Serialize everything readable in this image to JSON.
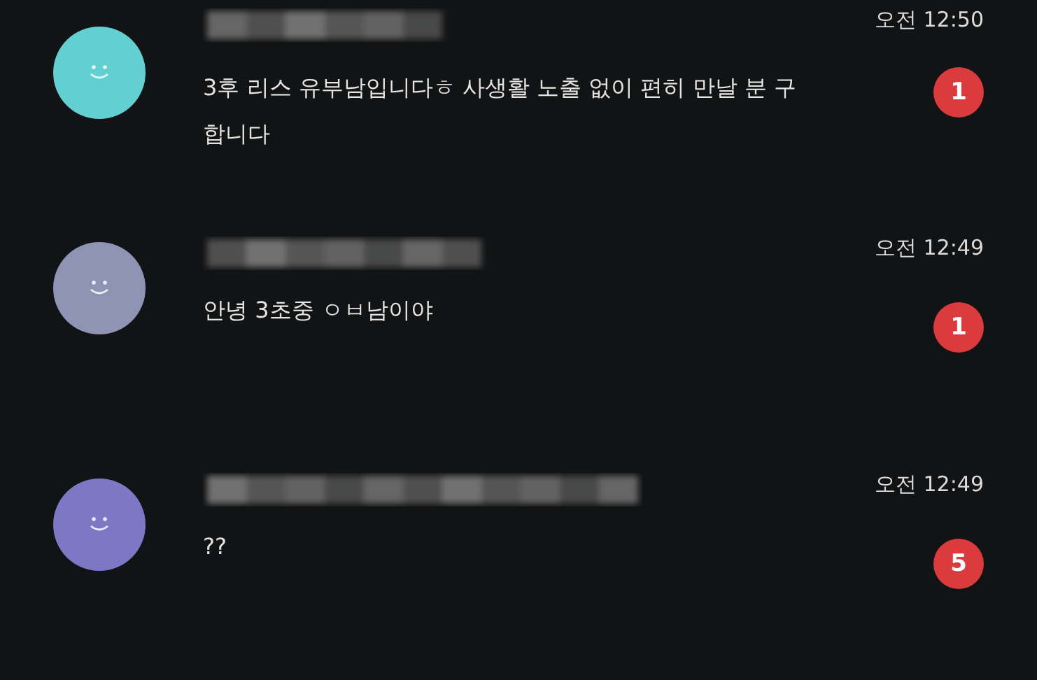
{
  "chats": [
    {
      "color": "#62d0d0",
      "time": "오전 12:50",
      "message": "3후 리스 유부남입니다ㅎ 사생활 노출 없이 편히 만날 분 구합니다",
      "unread": "1"
    },
    {
      "color": "#8f93b4",
      "time": "오전 12:49",
      "message": "안녕 3초중 ㅇㅂ남이야",
      "unread": "1"
    },
    {
      "color": "#7d78c6",
      "time": "오전 12:49",
      "message": "??",
      "unread": "5"
    }
  ]
}
